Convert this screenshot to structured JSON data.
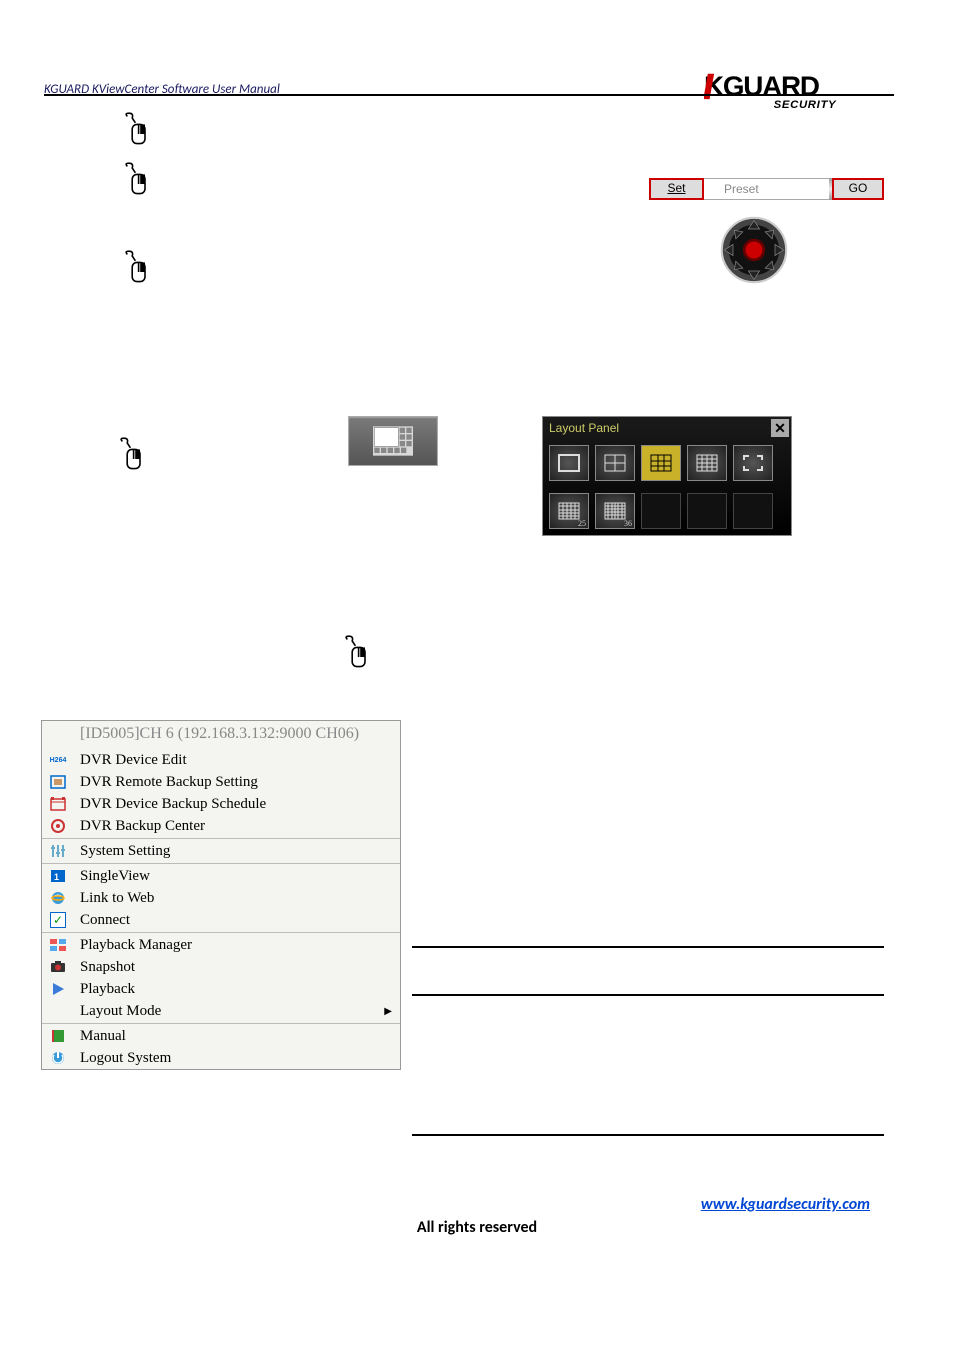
{
  "header": {
    "title": "KGUARD KViewCenter Software User Manual",
    "logo_main": "KGUARD",
    "logo_sub": "SECURITY"
  },
  "preset": {
    "set": "Set",
    "label": "Preset",
    "go": "GO"
  },
  "layout_panel": {
    "title": "Layout Panel",
    "sub1": "25",
    "sub2": "36"
  },
  "context_menu": {
    "title": "[ID5005]CH 6 (192.168.3.132:9000 CH06)",
    "items": [
      {
        "label": "DVR Device Edit",
        "icon": "h264"
      },
      {
        "label": "DVR Remote Backup Setting",
        "icon": "backup"
      },
      {
        "label": "DVR Device Backup Schedule",
        "icon": "schedule"
      },
      {
        "label": "DVR Backup Center",
        "icon": "center"
      },
      {
        "sep": true
      },
      {
        "label": "System Setting",
        "icon": "sliders"
      },
      {
        "sep": true
      },
      {
        "label": "SingleView",
        "icon": "single"
      },
      {
        "label": "Link to Web",
        "icon": "ie"
      },
      {
        "label": "Connect",
        "icon": "check"
      },
      {
        "sep": true
      },
      {
        "label": "Playback Manager",
        "icon": "pbmgr"
      },
      {
        "label": "Snapshot",
        "icon": "snap"
      },
      {
        "label": "Playback",
        "icon": "play"
      },
      {
        "label": "Layout Mode",
        "icon": "",
        "arrow": true
      },
      {
        "sep": true
      },
      {
        "label": "Manual",
        "icon": "book"
      },
      {
        "label": "Logout System",
        "icon": "logout"
      }
    ]
  },
  "footer": {
    "url_text": "www.kguardsecurity.com",
    "rights": "All rights reserved"
  }
}
